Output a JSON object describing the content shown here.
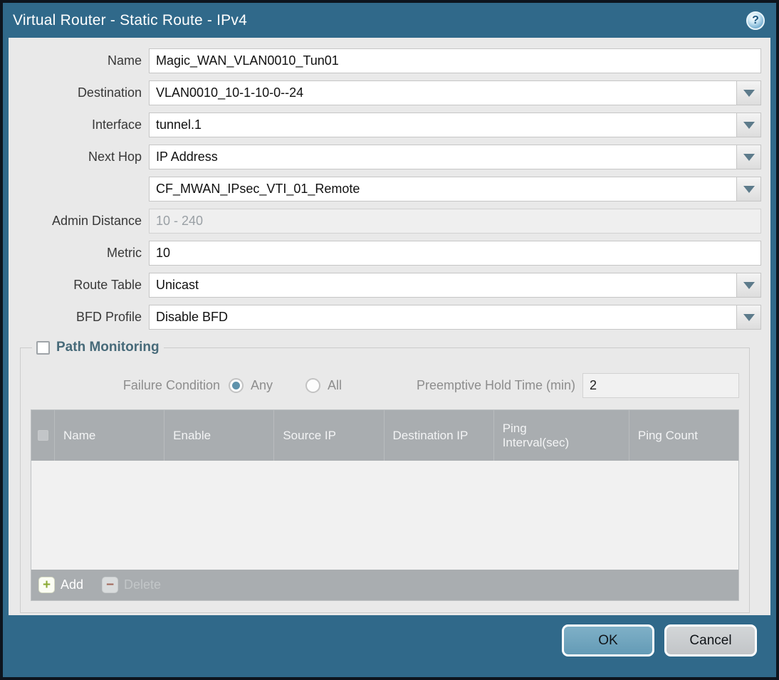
{
  "title_bar": {
    "title": "Virtual Router - Static Route - IPv4",
    "help_glyph": "?"
  },
  "form": {
    "fields": [
      {
        "label": "Name",
        "value": "Magic_WAN_VLAN0010_Tun01",
        "type": "text"
      },
      {
        "label": "Destination",
        "value": "VLAN0010_10-1-10-0--24",
        "type": "dropdown"
      },
      {
        "label": "Interface",
        "value": "tunnel.1",
        "type": "dropdown"
      },
      {
        "label": "Next Hop",
        "value": "IP Address",
        "type": "dropdown"
      },
      {
        "label": "",
        "value": "CF_MWAN_IPsec_VTI_01_Remote",
        "type": "dropdown"
      },
      {
        "label": "Admin Distance",
        "value": "",
        "placeholder": "10 - 240",
        "type": "text-disabled"
      },
      {
        "label": "Metric",
        "value": "10",
        "type": "text"
      },
      {
        "label": "Route Table",
        "value": "Unicast",
        "type": "dropdown"
      },
      {
        "label": "BFD Profile",
        "value": "Disable BFD",
        "type": "dropdown"
      }
    ]
  },
  "path_monitoring": {
    "legend": "Path Monitoring",
    "enabled": false,
    "failure_condition": {
      "label": "Failure Condition",
      "options": [
        {
          "label": "Any",
          "selected": true
        },
        {
          "label": "All",
          "selected": false
        }
      ]
    },
    "preemptive_hold_time": {
      "label": "Preemptive Hold Time (min)",
      "value": "2"
    },
    "table": {
      "columns": [
        "Name",
        "Enable",
        "Source IP",
        "Destination IP",
        "Ping Interval(sec)",
        "Ping Count"
      ],
      "rows": []
    },
    "toolbar": {
      "add_label": "Add",
      "delete_label": "Delete"
    }
  },
  "footer": {
    "ok_label": "OK",
    "cancel_label": "Cancel"
  },
  "colors": {
    "frame_teal": "#30698a",
    "content_bg": "#e9e9e9",
    "table_header_gray": "#a9adb0",
    "ok_button_blue": "#6fa4bf",
    "cancel_button_gray": "#c8cbce",
    "add_icon_green": "#8cab35",
    "delete_icon_red": "#a2695c",
    "radio_selected_blue": "#5e92ab",
    "dropdown_arrow": "#5d7b8b"
  }
}
